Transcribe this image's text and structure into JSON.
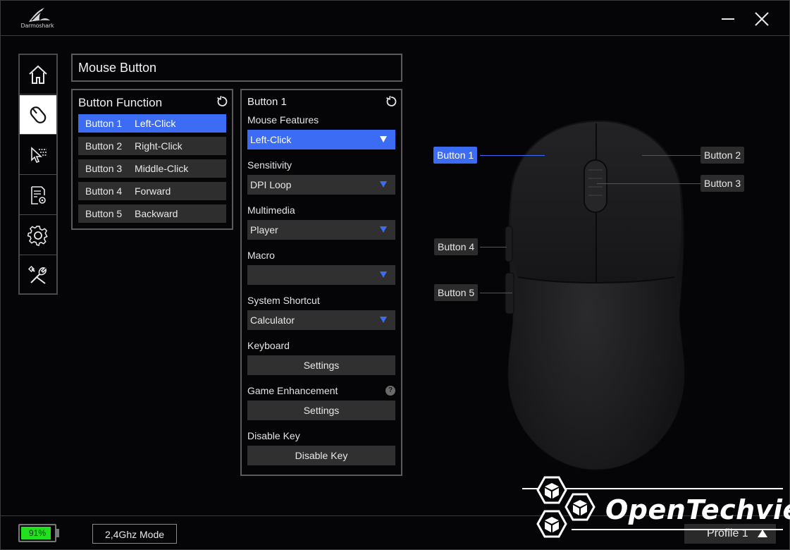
{
  "app": {
    "brand": "Darmoshark"
  },
  "window": {
    "minimize_label": "minimize",
    "close_label": "close"
  },
  "nav": {
    "items": [
      {
        "id": "home",
        "icon": "home-icon"
      },
      {
        "id": "mouse-button",
        "icon": "mouse-icon",
        "active": true
      },
      {
        "id": "performance",
        "icon": "cursor-icon"
      },
      {
        "id": "macro",
        "icon": "document-gear-icon"
      },
      {
        "id": "settings",
        "icon": "gear-icon"
      },
      {
        "id": "tools",
        "icon": "tools-icon"
      }
    ]
  },
  "page": {
    "title": "Mouse Button"
  },
  "button_function": {
    "heading": "Button Function",
    "rows": [
      {
        "button": "Button 1",
        "function": "Left-Click",
        "active": true
      },
      {
        "button": "Button 2",
        "function": "Right-Click"
      },
      {
        "button": "Button 3",
        "function": "Middle-Click"
      },
      {
        "button": "Button 4",
        "function": "Forward"
      },
      {
        "button": "Button 5",
        "function": "Backward"
      }
    ]
  },
  "button_detail": {
    "heading": "Button 1",
    "mouse_features": {
      "label": "Mouse Features",
      "value": "Left-Click"
    },
    "sensitivity": {
      "label": "Sensitivity",
      "value": "DPI Loop"
    },
    "multimedia": {
      "label": "Multimedia",
      "value": "Player"
    },
    "macro": {
      "label": "Macro",
      "value": ""
    },
    "system_shortcut": {
      "label": "System Shortcut",
      "value": "Calculator"
    },
    "keyboard": {
      "label": "Keyboard",
      "button": "Settings"
    },
    "game_enhancement": {
      "label": "Game Enhancement",
      "button": "Settings",
      "help": "?"
    },
    "disable_key": {
      "label": "Disable Key",
      "button": "Disable Key"
    }
  },
  "mouse_tags": {
    "b1": "Button 1",
    "b2": "Button 2",
    "b3": "Button 3",
    "b4": "Button 4",
    "b5": "Button 5"
  },
  "status": {
    "battery": "91%",
    "battery_level": 0.91,
    "mode": "2,4Ghz Mode",
    "profile": "Profile 1"
  },
  "watermark": {
    "text": "OpenTechview"
  },
  "colors": {
    "accent": "#3d6cf4",
    "battery": "#22e01f",
    "background": "#050507"
  }
}
